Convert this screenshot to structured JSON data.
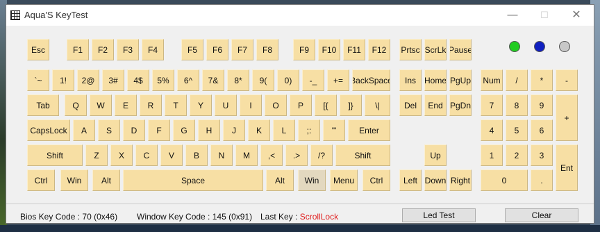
{
  "window": {
    "title": "Aqua'S KeyTest",
    "minimize": "—",
    "maximize": "☐",
    "close": "✕"
  },
  "keys": {
    "esc": "Esc",
    "f1": "F1",
    "f2": "F2",
    "f3": "F3",
    "f4": "F4",
    "f5": "F5",
    "f6": "F6",
    "f7": "F7",
    "f8": "F8",
    "f9": "F9",
    "f10": "F10",
    "f11": "F11",
    "f12": "F12",
    "prtsc": "Prtsc",
    "scrlk": "ScrLk",
    "pause": "Pause",
    "tilde": "`~",
    "d1": "1!",
    "d2": "2@",
    "d3": "3#",
    "d4": "4$",
    "d5": "5%",
    "d6": "6^",
    "d7": "7&",
    "d8": "8*",
    "d9": "9(",
    "d0": "0)",
    "minus": "-_",
    "equals": "+=",
    "backspace": "BackSpace",
    "ins": "Ins",
    "home": "Home",
    "pgup": "PgUp",
    "num": "Num",
    "kp_div": "/",
    "kp_mul": "*",
    "kp_minus": "-",
    "tab": "Tab",
    "q": "Q",
    "w": "W",
    "e": "E",
    "r": "R",
    "t": "T",
    "y": "Y",
    "u": "U",
    "i": "I",
    "o": "O",
    "p": "P",
    "lbracket": "[{",
    "rbracket": "]}",
    "backslash": "\\|",
    "del": "Del",
    "end": "End",
    "pgdn": "PgDn",
    "kp7": "7",
    "kp8": "8",
    "kp9": "9",
    "kp_plus": "+",
    "capslock": "CapsLock",
    "a": "A",
    "s": "S",
    "d": "D",
    "f": "F",
    "g": "G",
    "h": "H",
    "j": "J",
    "k": "K",
    "l": "L",
    "semicolon": ";:",
    "quote": "'\"",
    "enter": "Enter",
    "kp4": "4",
    "kp5": "5",
    "kp6": "6",
    "lshift": "Shift",
    "z": "Z",
    "x": "X",
    "c": "C",
    "v": "V",
    "b": "B",
    "n": "N",
    "m": "M",
    "comma": ",<",
    "period": ".>",
    "slash": "/?",
    "rshift": "Shift",
    "up": "Up",
    "kp1": "1",
    "kp2": "2",
    "kp3": "3",
    "kp_enter": "Ent",
    "lctrl": "Ctrl",
    "lwin": "Win",
    "lalt": "Alt",
    "space": "Space",
    "ralt": "Alt",
    "rwin": "Win",
    "menu": "Menu",
    "rctrl": "Ctrl",
    "left": "Left",
    "down": "Down",
    "right": "Right",
    "kp0": "0",
    "kp_dot": "."
  },
  "leds": {
    "num_color": "#22cc22",
    "caps_color": "#1020c0",
    "scroll_color": "#c8c8c8"
  },
  "status": {
    "bios_label": "Bios Key Code :",
    "bios_value": "70 (0x46)",
    "window_label": "Window Key Code :",
    "window_value": "145 (0x91)",
    "last_label": "Last Key :",
    "last_value": "ScrollLock",
    "led_test": "Led Test",
    "clear": "Clear"
  }
}
